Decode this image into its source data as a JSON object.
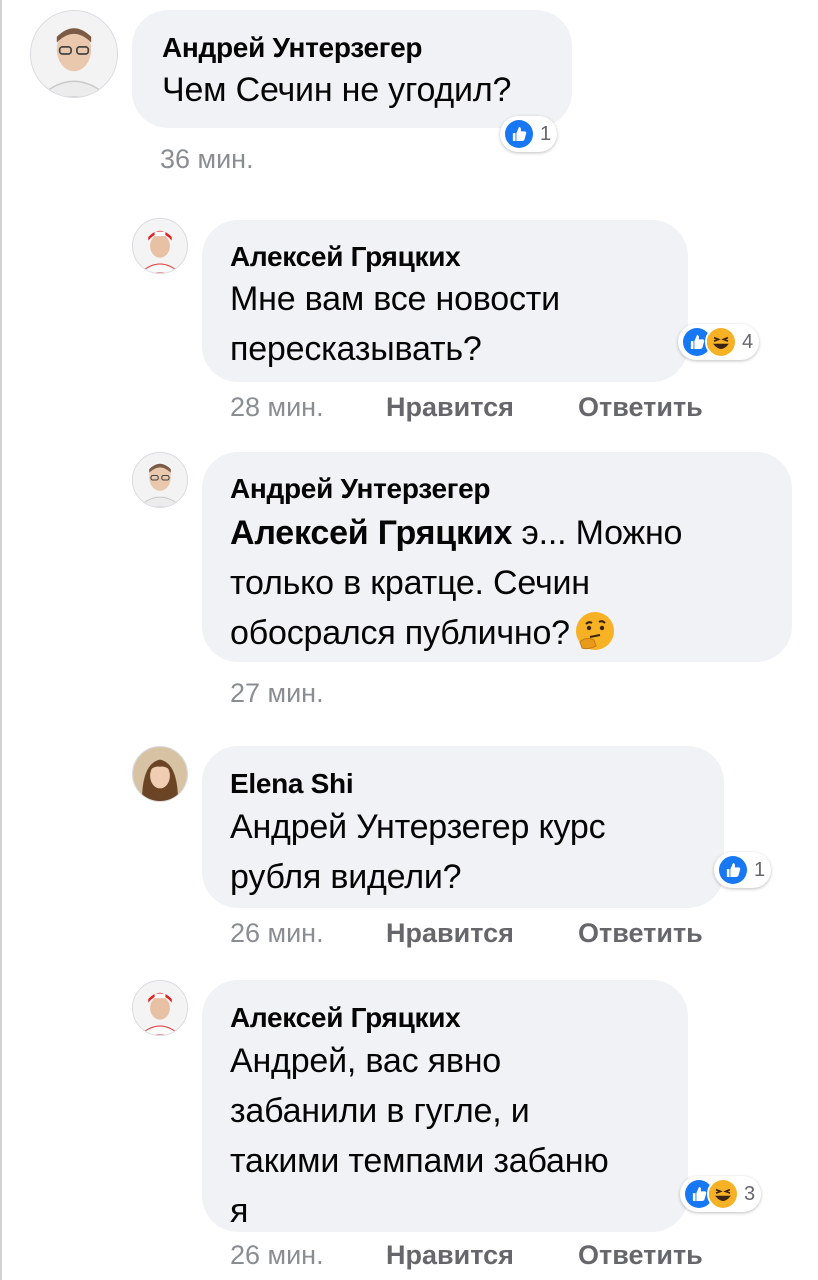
{
  "comments": [
    {
      "author": "Андрей Унтерзегер",
      "lines": [
        "Чем Сечин не угодил?"
      ],
      "time": "36 мин.",
      "reaction_count": "1"
    },
    {
      "author": "Алексей Гряцких",
      "lines": [
        "Мне вам все новости",
        "пересказывать?"
      ],
      "time": "28 мин.",
      "like": "Нравится",
      "reply": "Ответить",
      "reaction_count": "4"
    },
    {
      "author": "Андрей Унтерзегер",
      "mention": "Алексей Гряцких",
      "line1_rest": " э... Можно",
      "line2": "только в кратце. Сечин",
      "line3": "обосрался публично?",
      "time": "27 мин."
    },
    {
      "author": "Elena Shi",
      "lines": [
        "Андрей Унтерзегер курс",
        "рубля видели?"
      ],
      "time": "26 мин.",
      "like": "Нравится",
      "reply": "Ответить",
      "reaction_count": "1"
    },
    {
      "author": "Алексей Гряцких",
      "lines": [
        "Андрей, вас явно",
        "забанили в гугле, и",
        "такими темпами забаню",
        "я"
      ],
      "time": "26 мин.",
      "like": "Нравится",
      "reply": "Ответить",
      "reaction_count": "3"
    }
  ],
  "icons": {
    "like": "thumbs-up-icon",
    "haha": "laughing-face-icon",
    "thinking": "thinking-face-emoji"
  },
  "colors": {
    "bubble": "#f0f2f5",
    "like_blue": "#1877f2",
    "haha_yellow": "#f7b125",
    "meta_gray": "#8a8d91"
  }
}
